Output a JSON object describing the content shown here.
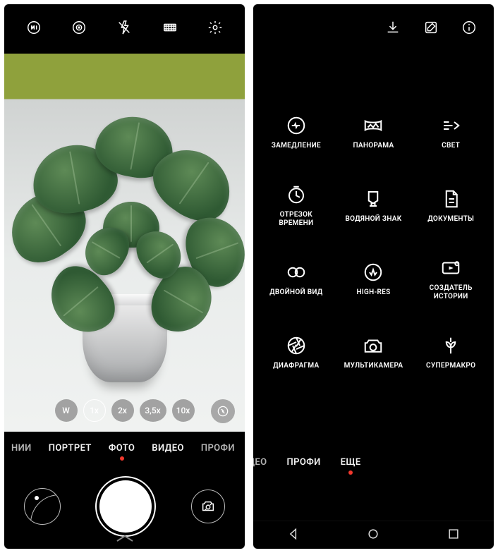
{
  "left": {
    "topbar": {
      "icons": [
        "ai-icon",
        "target-icon",
        "flash-off-icon",
        "filmstrip-icon",
        "settings-icon"
      ]
    },
    "zoom": {
      "options": [
        "W",
        "1x",
        "2x",
        "3,5x",
        "10x"
      ],
      "active_index": 1
    },
    "modes": {
      "items": [
        "НИИ",
        "ПОРТРЕТ",
        "ФОТО",
        "ВИДЕО",
        "ПРОФИ"
      ],
      "active_index": 2
    }
  },
  "right": {
    "topbar": {
      "icons": [
        "download-icon",
        "edit-icon",
        "info-icon"
      ]
    },
    "grid": [
      {
        "icon": "slowmo-icon",
        "label": "ЗАМЕДЛЕНИЕ"
      },
      {
        "icon": "panorama-icon",
        "label": "ПАНОРАМА"
      },
      {
        "icon": "light-icon",
        "label": "СВЕТ"
      },
      {
        "icon": "timelapse-icon",
        "label": "ОТРЕЗОК\nВРЕМЕНИ"
      },
      {
        "icon": "watermark-icon",
        "label": "ВОДЯНОЙ ЗНАК"
      },
      {
        "icon": "documents-icon",
        "label": "ДОКУМЕНТЫ"
      },
      {
        "icon": "dualview-icon",
        "label": "ДВОЙНОЙ ВИД"
      },
      {
        "icon": "highres-icon",
        "label": "HIGH-RES"
      },
      {
        "icon": "story-icon",
        "label": "СОЗДАТЕЛЬ\nИСТОРИИ"
      },
      {
        "icon": "aperture-icon",
        "label": "ДИАФРАГМА"
      },
      {
        "icon": "multicam-icon",
        "label": "МУЛЬТИКАМЕРА"
      },
      {
        "icon": "macro-icon",
        "label": "СУПЕРМАКРО"
      }
    ],
    "modes": {
      "items": [
        "ВИДЕО",
        "ПРОФИ",
        "ЕЩЕ"
      ],
      "active_index": 2
    },
    "navbar": [
      "back-icon",
      "home-icon",
      "recent-icon"
    ]
  }
}
